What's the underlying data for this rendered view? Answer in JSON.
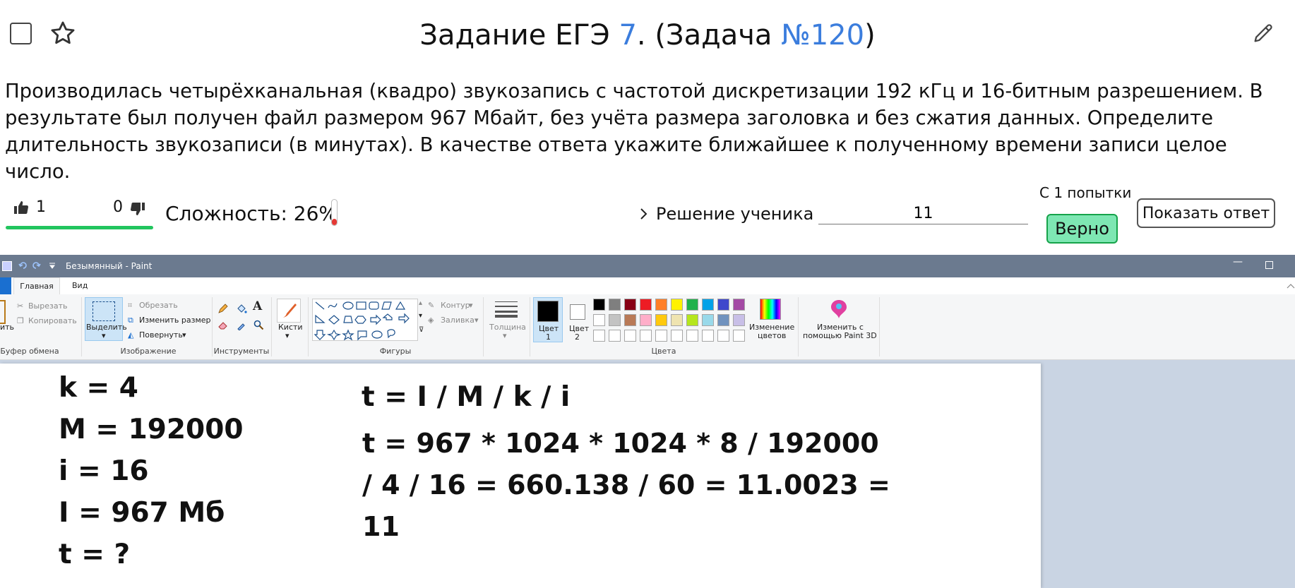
{
  "header": {
    "title_prefix": "Задание ЕГЭ ",
    "task_number": "7",
    "title_middle": ". (Задача ",
    "problem_link": "№120",
    "title_suffix": ")"
  },
  "statement": "Производилась четырёхканальная (квадро) звукозапись с частотой дискретизации 192 кГц и 16-битным разрешением. В результате был получен файл размером 967 Мбайт, без учёта размера заголовка и без сжатия данных. Определите длительность звукозаписи (в минутах). В качестве ответа укажите ближайшее к полученному времени записи целое число.",
  "votes": {
    "up": "1",
    "down": "0",
    "approval_fraction": 1.0
  },
  "difficulty": {
    "label": "Сложность: 26%",
    "value_percent": 26
  },
  "solution_toggle": "Решение ученика",
  "answer": {
    "value": "11"
  },
  "attempts": "С 1 попытки",
  "verdict": "Верно",
  "show_answer": "Показать ответ",
  "colors": {
    "accent_link": "#3b7ddd",
    "vote_bar": "#22c55e",
    "verdict_bg": "#7ee7b3",
    "difficulty_fill": "#e53935"
  },
  "paint": {
    "window_title": "Безымянный - Paint",
    "tabs": {
      "file": "",
      "home": "Главная",
      "view": "Вид"
    },
    "ribbon": {
      "clipboard": {
        "paste": "ить",
        "cut": "Вырезать",
        "copy": "Копировать",
        "label": "Буфер обмена"
      },
      "image": {
        "select": "Выделить",
        "crop": "Обрезать",
        "resize": "Изменить размер",
        "rotate": "Повернуть",
        "label": "Изображение"
      },
      "tools": {
        "label": "Инструменты"
      },
      "brushes": "Кисти",
      "shapes": {
        "outline": "Контур",
        "fill": "Заливка",
        "label": "Фигуры"
      },
      "size": "Толщина",
      "color1": [
        "Цвет",
        "1"
      ],
      "color2": [
        "Цвет",
        "2"
      ],
      "colors_label": "Цвета",
      "edit_colors": [
        "Изменение",
        "цветов"
      ],
      "paint3d": [
        "Изменить с",
        "помощью Paint 3D"
      ]
    },
    "palette_row1": [
      "#000000",
      "#7f7f7f",
      "#880015",
      "#ed1c24",
      "#ff7f27",
      "#fff200",
      "#22b14c",
      "#00a2e8",
      "#3f48cc",
      "#a349a4"
    ],
    "palette_row2": [
      "#ffffff",
      "#c3c3c3",
      "#b97a57",
      "#ffaec9",
      "#ffc90e",
      "#efe4b0",
      "#b5e61d",
      "#99d9ea",
      "#7092be",
      "#c8bfe7"
    ],
    "canvas": {
      "given": [
        "k = 4",
        "M = 192000",
        "i = 16",
        "I = 967 Мб",
        "t = ?"
      ],
      "formula": "t = I / M / k / i",
      "calc": [
        "t = 967 * 1024 * 1024 * 8 / 192000",
        "/ 4 / 16 = 660.138 / 60 = 11.0023 =",
        "11"
      ]
    }
  }
}
